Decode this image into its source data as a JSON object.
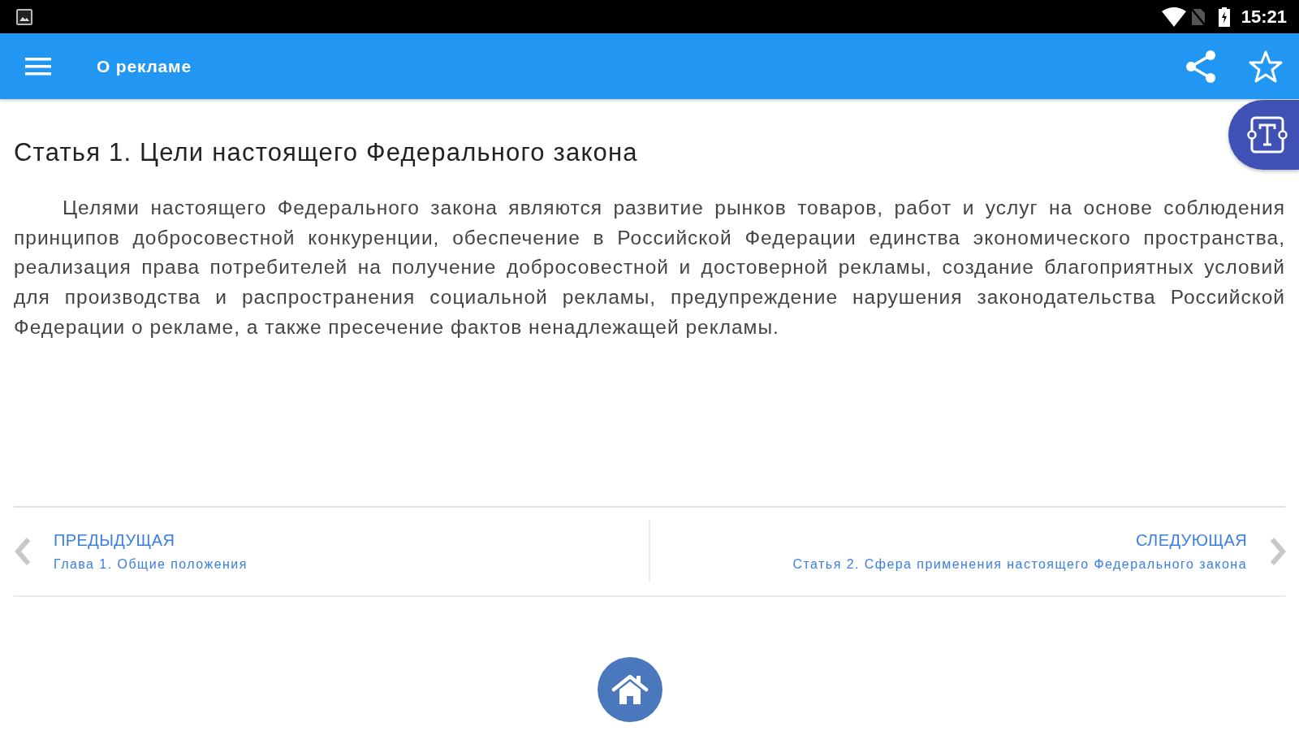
{
  "status_bar": {
    "time": "15:21"
  },
  "app_bar": {
    "title": "О рекламе",
    "starred": false
  },
  "article": {
    "title": "Статья 1. Цели настоящего Федерального закона",
    "paragraphs": [
      "Целями настоящего Федерального закона являются развитие рынков товаров, работ и услуг на основе соблюдения принципов добросовестной конкуренции, обеспечение в Российской Федерации единства экономического пространства, реализация права потребителей на получение добросовестной и достоверной рекламы, создание благоприятных условий для производства и распространения социальной рекламы, предупреждение нарушения законодательства Российской Федерации о рекламе, а также пресечение фактов ненадлежащей рекламы."
    ]
  },
  "navigation": {
    "previous": {
      "label": "ПРЕДЫДУЩАЯ",
      "title": "Глава 1. Общие положения"
    },
    "next": {
      "label": "СЛЕДУЮЩАЯ",
      "title": "Статья 2. Сфера применения настоящего Федерального закона"
    }
  }
}
